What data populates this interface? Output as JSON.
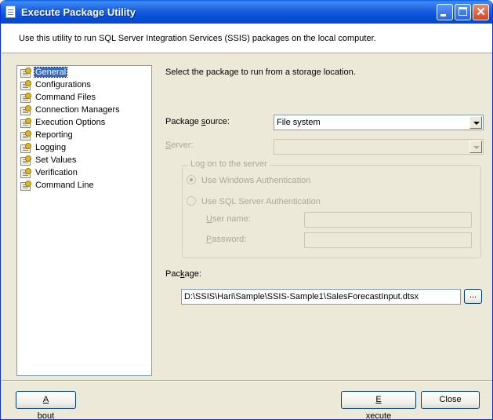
{
  "window": {
    "title": "Execute Package Utility",
    "buttons": {
      "minimize": "minimize-icon",
      "maximize": "maximize-icon",
      "close_glyph": "✕"
    }
  },
  "header": {
    "description": "Use this utility to run SQL Server Integration Services (SSIS) packages on the local computer."
  },
  "sidebar": {
    "items": [
      {
        "label": "General",
        "selected": true
      },
      {
        "label": "Configurations"
      },
      {
        "label": "Command Files"
      },
      {
        "label": "Connection Managers"
      },
      {
        "label": "Execution Options"
      },
      {
        "label": "Reporting"
      },
      {
        "label": "Logging"
      },
      {
        "label": "Set Values"
      },
      {
        "label": "Verification"
      },
      {
        "label": "Command Line"
      }
    ]
  },
  "general": {
    "instruction": "Select the package to run from a storage location.",
    "package_source": {
      "label_pre": "Package ",
      "label_key": "s",
      "label_post": "ource:",
      "value": "File system"
    },
    "server": {
      "label_key": "S",
      "label_post": "erver:",
      "value": ""
    },
    "logon": {
      "title": "Log on to the server",
      "windows_auth": "Use Windows Authentication",
      "sql_auth": "Use SQL Server Authentication",
      "username": {
        "label_key": "U",
        "label_post": "ser name:",
        "value": ""
      },
      "password": {
        "label_key": "P",
        "label_post": "assword:",
        "value": ""
      }
    },
    "package": {
      "label_pre": "Pac",
      "label_key": "k",
      "label_post": "age:",
      "value": "D:\\SSIS\\Hari\\Sample\\SSIS-Sample1\\SalesForecastInput.dtsx",
      "browse_label": "..."
    }
  },
  "footer": {
    "about": {
      "key": "A",
      "rest": "bout"
    },
    "execute": {
      "key": "E",
      "rest": "xecute"
    },
    "close": "Close"
  },
  "colors": {
    "selection": "#316ac5",
    "titlebar": "#0551d8",
    "face": "#ece9d8"
  }
}
